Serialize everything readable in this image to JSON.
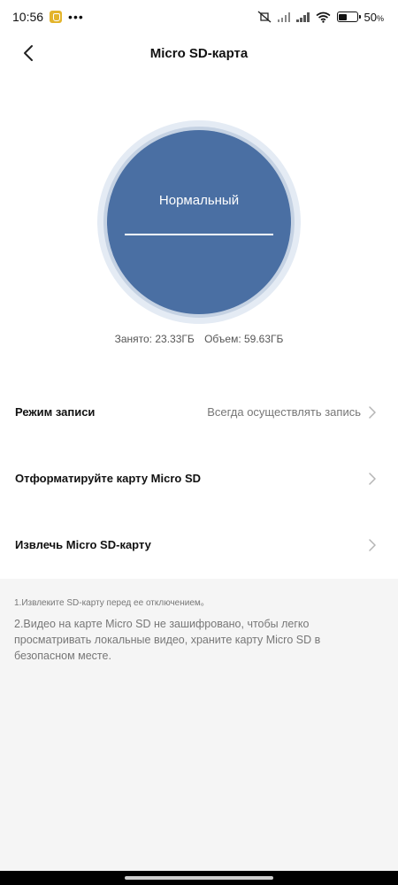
{
  "status_bar": {
    "time": "10:56",
    "dots": "•••",
    "battery_percent": "50",
    "percent_sign": "%",
    "battery_level": 0.5
  },
  "nav": {
    "title": "Micro SD-карта"
  },
  "gauge": {
    "status": "Нормальный",
    "accent_color": "#4a6fa3"
  },
  "storage": {
    "used": "Занято: 23.33ГБ",
    "total": "Объем: 59.63ГБ"
  },
  "menu": {
    "items": [
      {
        "label": "Режим записи",
        "value": "Всегда осуществлять запись"
      },
      {
        "label": "Отформатируйте карту Micro SD",
        "value": ""
      },
      {
        "label": "Извлечь Micro SD-карту",
        "value": ""
      }
    ]
  },
  "notes": {
    "note1": "1.Извлеките SD-карту перед ее отключением。",
    "note2": "2.Видео на карте Micro SD не зашифровано, чтобы легко просматривать локальные видео, храните карту Micro SD в безопасном месте."
  }
}
